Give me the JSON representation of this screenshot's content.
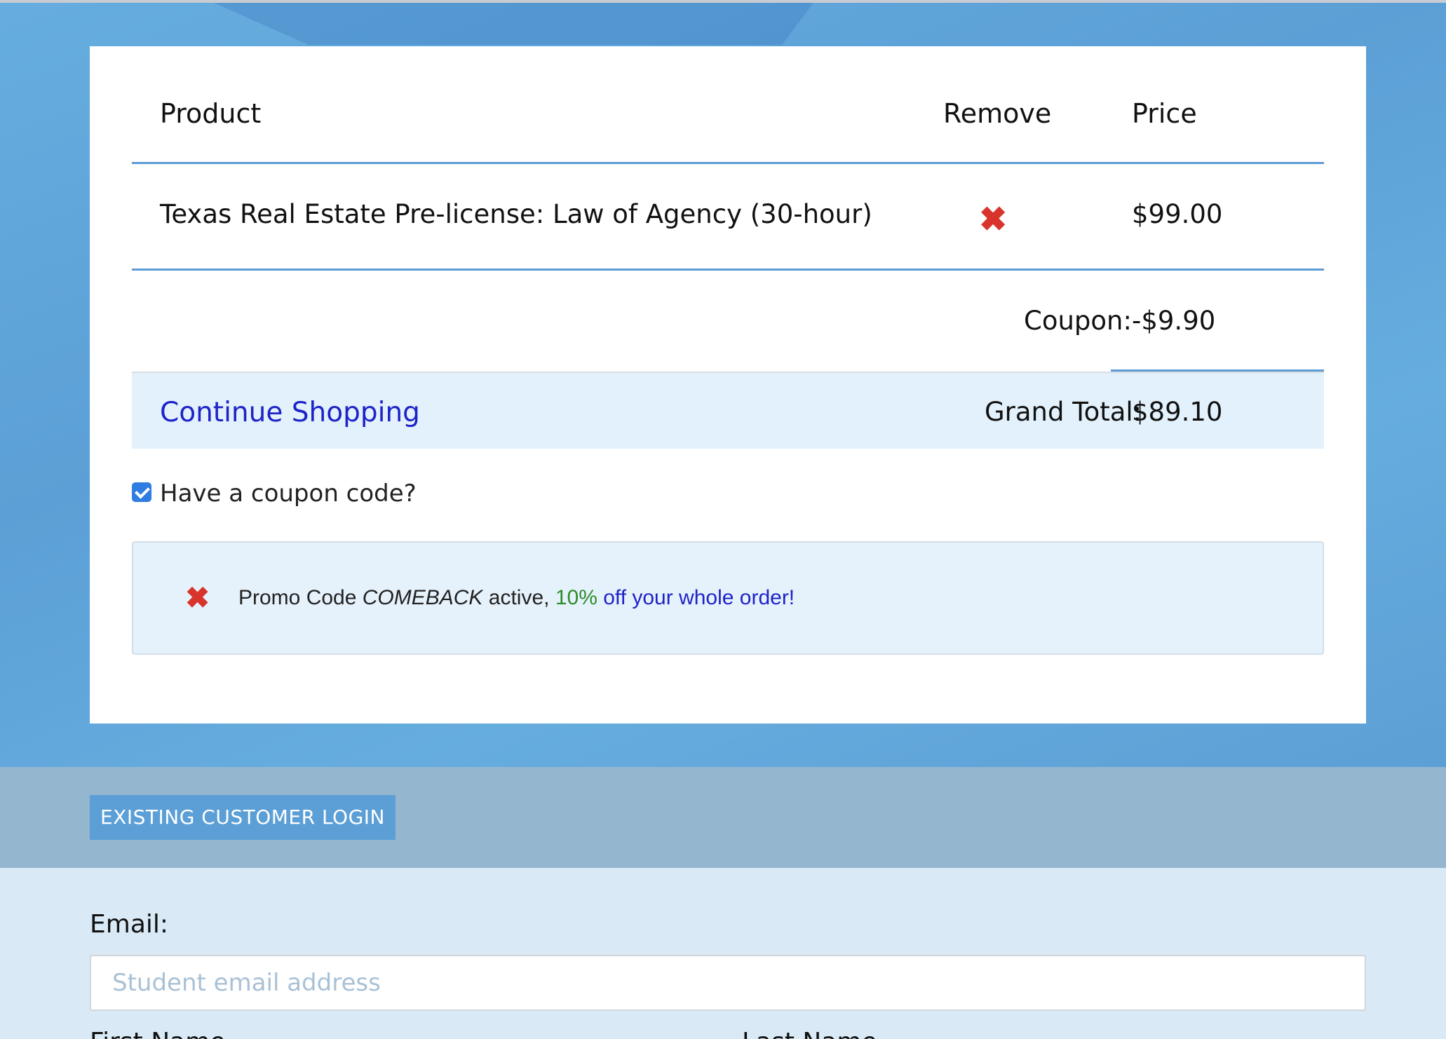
{
  "cart": {
    "headers": {
      "product": "Product",
      "remove": "Remove",
      "price": "Price"
    },
    "items": [
      {
        "name": "Texas Real Estate Pre-license: Law of Agency (30-hour)",
        "price": "$99.00"
      }
    ],
    "coupon_label": "Coupon:",
    "coupon_value": "-$9.90",
    "continue_label": "Continue Shopping",
    "grand_total_label": "Grand Total:",
    "grand_total_value": "$89.10"
  },
  "coupon_toggle": {
    "label": "Have a coupon code?",
    "checked": true
  },
  "promo": {
    "prefix": "Promo Code ",
    "code": "COMEBACK",
    "middle": " active, ",
    "percent": "10%",
    "suffix": " off your whole order!"
  },
  "login": {
    "button_label": "EXISTING CUSTOMER LOGIN"
  },
  "form": {
    "email_label": "Email:",
    "email_placeholder": "Student email address",
    "first_name_label": "First Name",
    "last_name_label": "Last Name"
  },
  "colors": {
    "accent_blue": "#5b9fd6",
    "link_blue": "#1e23c8",
    "remove_red": "#d9342b",
    "promo_green": "#2e8b2e"
  }
}
